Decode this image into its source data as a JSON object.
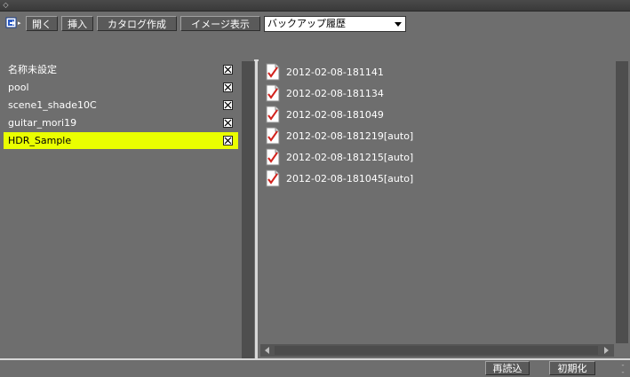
{
  "toolbar": {
    "open_label": "開く",
    "insert_label": "挿入",
    "catalog_label": "カタログ作成",
    "image_view_label": "イメージ表示",
    "history_select": {
      "selected": "バックアップ履歴"
    }
  },
  "left_list": {
    "items": [
      {
        "label": "名称未設定",
        "selected": false
      },
      {
        "label": "pool",
        "selected": false
      },
      {
        "label": "scene1_shade10C",
        "selected": false
      },
      {
        "label": "guitar_mori19",
        "selected": false
      },
      {
        "label": "HDR_Sample",
        "selected": true
      }
    ],
    "selected_color": "#eaff00"
  },
  "right_list": {
    "items": [
      {
        "label": "2012-02-08-181141",
        "icon": "document-check-icon"
      },
      {
        "label": "2012-02-08-181134",
        "icon": "document-check-icon"
      },
      {
        "label": "2012-02-08-181049",
        "icon": "document-check-icon"
      },
      {
        "label": "2012-02-08-181219[auto]",
        "icon": "document-check-icon"
      },
      {
        "label": "2012-02-08-181215[auto]",
        "icon": "document-check-icon"
      },
      {
        "label": "2012-02-08-181045[auto]",
        "icon": "document-check-icon"
      }
    ]
  },
  "bottom": {
    "reload_label": "再読込",
    "reset_label": "初期化"
  },
  "colors": {
    "background": "#6e6e6e",
    "highlight": "#eaff00",
    "check_red": "#d2231e"
  }
}
